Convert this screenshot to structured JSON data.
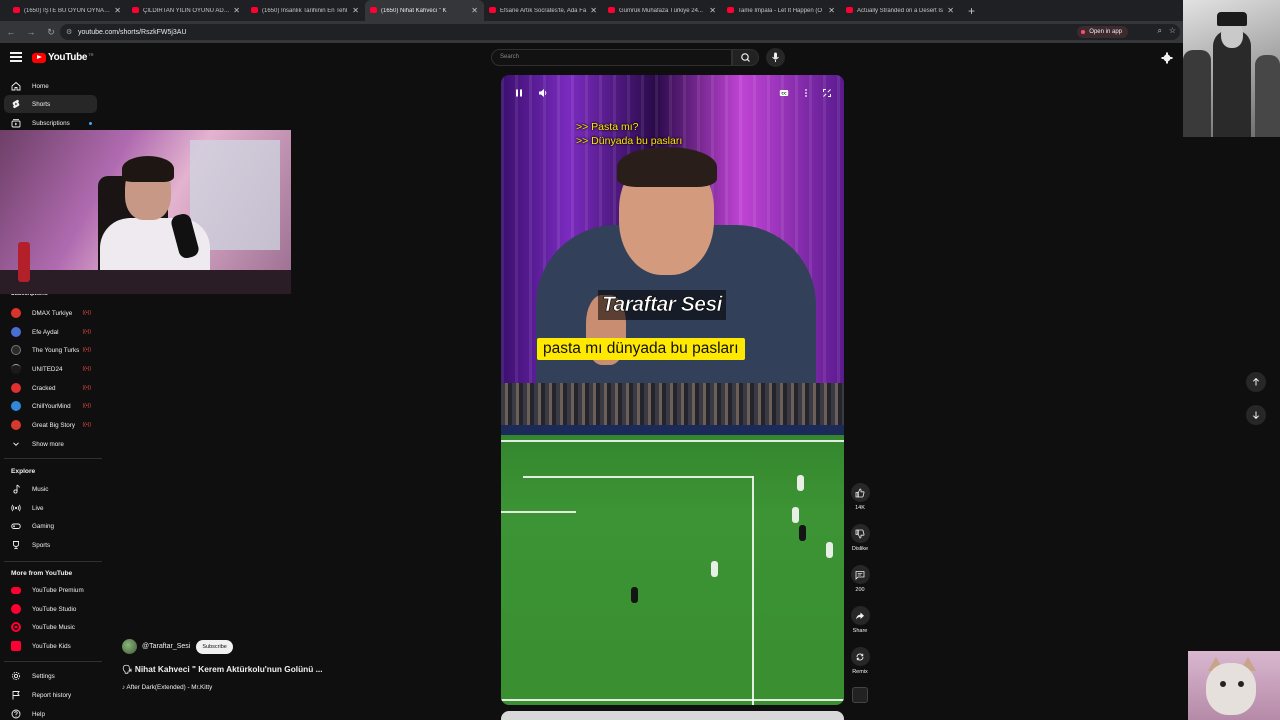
{
  "browser": {
    "tabs": [
      {
        "label": "(1650) İŞTE BU OYUN OYNANIR"
      },
      {
        "label": "ÇILDIRTAN YILIN OYUNU ADAM"
      },
      {
        "label": "(1650) İnsanlık Tarihinin En Tehl"
      },
      {
        "label": "(1650) Nihat Kahveci \" K"
      },
      {
        "label": "Efsane Artık Socrates'te, Ada Fa"
      },
      {
        "label": "Gümrük Muhafaza Türkiye 24..."
      },
      {
        "label": "Tame Impala - Let It Happen (O"
      },
      {
        "label": "Actually Stranded on a Desert Is"
      }
    ],
    "url": "youtube.com/shorts/RszkFW5j3AU",
    "open_in_app": "Open in app"
  },
  "header": {
    "logo": "YouTube",
    "logo_country": "TR",
    "search_placeholder": "Search"
  },
  "sidebar": {
    "main": [
      {
        "label": "Home",
        "icon": "home-icon"
      },
      {
        "label": "Shorts",
        "icon": "shorts-icon"
      },
      {
        "label": "Subscriptions",
        "icon": "subscriptions-icon"
      }
    ],
    "subscriptions_title": "Subscriptions",
    "channels": [
      {
        "label": "DMAX Turkiye",
        "color": "#d9342b"
      },
      {
        "label": "Efe Aydal",
        "color": "#4a6fd4"
      },
      {
        "label": "The Young Turks",
        "color": "#2a2a2a"
      },
      {
        "label": "UNITED24",
        "color": "#1a1a1a"
      },
      {
        "label": "Cracked",
        "color": "#e03030"
      },
      {
        "label": "ChillYourMind",
        "color": "#2f88d8"
      },
      {
        "label": "Great Big Story",
        "color": "#d8382e"
      }
    ],
    "show_more": "Show more",
    "explore_title": "Explore",
    "explore": [
      {
        "label": "Music",
        "icon": "music-icon"
      },
      {
        "label": "Live",
        "icon": "live-icon"
      },
      {
        "label": "Gaming",
        "icon": "gaming-icon"
      },
      {
        "label": "Sports",
        "icon": "sports-icon"
      }
    ],
    "more_title": "More from YouTube",
    "more": [
      {
        "label": "YouTube Premium",
        "color": "#ff0033"
      },
      {
        "label": "YouTube Studio",
        "color": "#ff0033"
      },
      {
        "label": "YouTube Music",
        "color": "#ff0033"
      },
      {
        "label": "YouTube Kids",
        "color": "#ff0033"
      }
    ],
    "footer": [
      {
        "label": "Settings",
        "icon": "gear-icon"
      },
      {
        "label": "Report history",
        "icon": "flag-icon"
      },
      {
        "label": "Help",
        "icon": "help-icon"
      }
    ]
  },
  "short": {
    "caption_line1": ">> Pasta mı?",
    "caption_line2": ">> Dünyada bu pasları",
    "brand": "Taraftar Sesi",
    "subtitle": "pasta mı dünyada bu pasları"
  },
  "actions": {
    "like_count": "14K",
    "dislike_label": "Dislike",
    "comment_count": "200",
    "share_label": "Share",
    "remix_label": "Remix"
  },
  "channel": {
    "handle": "@Taraftar_Sesi",
    "subscribe_label": "Subscribe",
    "title": "🗣 Nihat Kahveci \" Kerem Aktürkolu'nun Golünü ...",
    "music": "♪ After Dark(Extended) - Mr.Kitty"
  },
  "colors": {
    "accent": "#ff0033",
    "caption_yellow": "#ffe600",
    "subtitle_bg": "#ffe900"
  }
}
